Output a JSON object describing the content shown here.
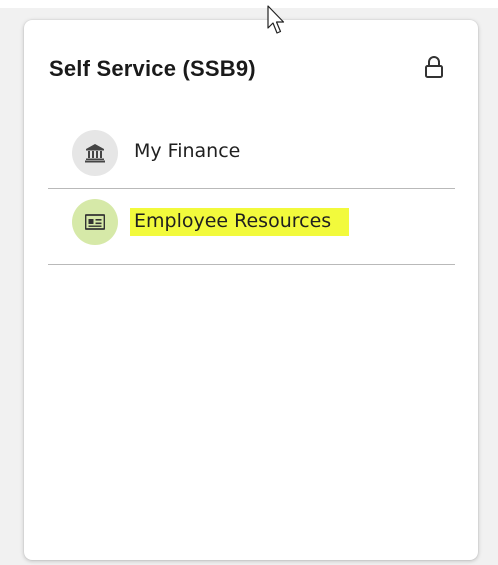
{
  "card": {
    "title": "Self Service (SSB9)",
    "lock_icon": "padlock-icon",
    "items": [
      {
        "label": "My Finance",
        "icon": "bank-building-icon"
      },
      {
        "label": "Employee Resources",
        "icon": "id-card-icon",
        "highlighted": true
      }
    ]
  },
  "colors": {
    "highlight": "#f2fa3c",
    "divider": "#b9b9b9",
    "icon_circle": "#e6e6e6"
  }
}
